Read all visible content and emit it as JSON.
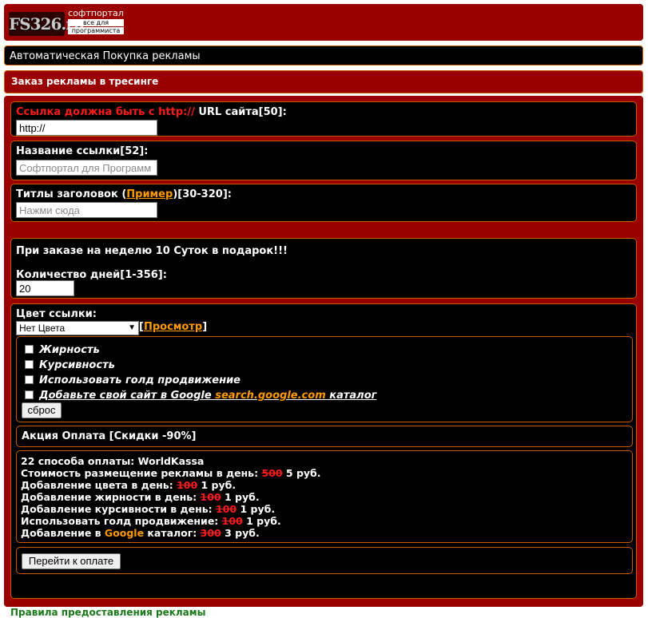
{
  "header": {
    "logo_text": "FS326.ru",
    "logo_line1": "софтпортал",
    "logo_line2": "все для",
    "logo_line3": "программиста"
  },
  "nav_bar": {
    "text": "Автоматическая Покупка рекламы"
  },
  "section_title": "Заказ рекламы в тресинге",
  "url": {
    "warning": "Ссылка должна быть с http://",
    "label": " URL сайта[50]:",
    "value": "http://"
  },
  "link_name": {
    "label": "Название ссылки[52]:",
    "placeholder": "Софтпортал для Программ"
  },
  "titles": {
    "label_prefix": "Титлы заголовок (",
    "example_link": "Пример",
    "label_suffix": ")[30-320]:",
    "placeholder": "Нажми сюда"
  },
  "days": {
    "promo": "При заказе на неделю 10 Суток в подарок!!!",
    "label": "Количество дней[1-356]:",
    "value": "20"
  },
  "color": {
    "label": "Цвет ссылки:",
    "selected": "Нет Цвета",
    "preview_open": "[",
    "preview_link": "Просмотр",
    "preview_close": "]"
  },
  "options": {
    "bold": "Жирность",
    "italic": "Курсивность",
    "gold": "Использовать голд продвижение",
    "google_prefix": "Добавьте свой сайт в Google ",
    "google_link": "search.google.com",
    "google_suffix": " каталог",
    "reset_button": "сброс"
  },
  "promo_bar": "Акция Оплата [Скидки -90%]",
  "pricing": {
    "methods": "22 способа оплаты: WorldKassa",
    "line1_label": "Стоимость размещение рекламы в день: ",
    "line1_old": "500",
    "line1_new": " 5 руб.",
    "line2_label": "Добавление цвета в день: ",
    "line2_old": "100",
    "line2_new": " 1 руб.",
    "line3_label": "Добавление жирности в день: ",
    "line3_old": "100",
    "line3_new": " 1 руб.",
    "line4_label": "Добавление курсивности в день: ",
    "line4_old": "100",
    "line4_new": " 1 руб.",
    "line5_label": "Использовать голд продвижение: ",
    "line5_old": "100",
    "line5_new": " 1 руб.",
    "line6_prefix": "Добавление в ",
    "line6_google": "Google",
    "line6_suffix": " каталог: ",
    "line6_old": "300",
    "line6_new": " 3 руб."
  },
  "pay_button": "Перейти к оплате",
  "footer_cut": "Правила предоставления рекламы"
}
